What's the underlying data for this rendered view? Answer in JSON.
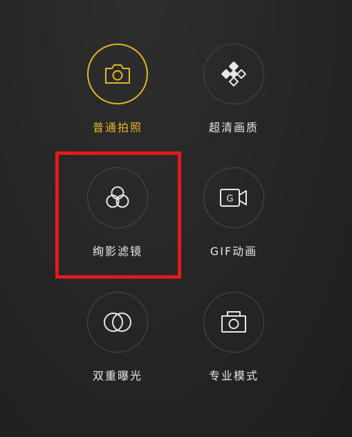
{
  "camera_modes": [
    {
      "label": "普通拍照",
      "icon": "camera-icon",
      "active": true
    },
    {
      "label": "超清画质",
      "icon": "diamond-grid-icon",
      "active": false
    },
    {
      "label": "绚影滤镜",
      "icon": "filter-circles-icon",
      "active": false
    },
    {
      "label": "GIF动画",
      "icon": "gif-video-icon",
      "active": false
    },
    {
      "label": "双重曝光",
      "icon": "double-exposure-icon",
      "active": false
    },
    {
      "label": "专业模式",
      "icon": "pro-camera-icon",
      "active": false
    }
  ],
  "colors": {
    "background": "#262626",
    "accent": "#e6b822",
    "highlight_box": "#e31a1a",
    "text": "#e8e8e8",
    "circle_border": "#4a4a4a"
  }
}
